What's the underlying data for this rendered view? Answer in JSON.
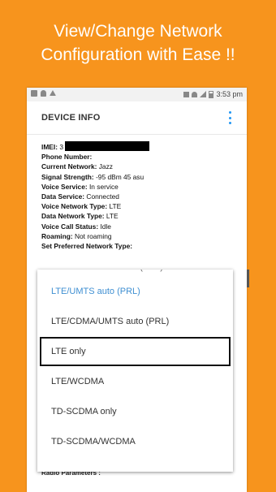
{
  "headline": {
    "line1": "View/Change Network",
    "line2": "Configuration with Ease !!"
  },
  "status_bar": {
    "time": "3:53 pm",
    "left_icons": [
      "gallery-icon",
      "notification-icon",
      "upload-icon"
    ],
    "right_icons": [
      "nfc-icon",
      "wifi-icon",
      "signal-icon",
      "battery-icon"
    ]
  },
  "appbar": {
    "title": "DEVICE INFO",
    "menu_icon": "more-vert-icon"
  },
  "device_info": [
    {
      "label": "IMEI:",
      "value": "3",
      "redacted": true
    },
    {
      "label": "Phone Number:",
      "value": ""
    },
    {
      "label": "Current Network:",
      "value": "Jazz"
    },
    {
      "label": "Signal Strength:",
      "value": "-95 dBm   45 asu"
    },
    {
      "label": "Voice Service:",
      "value": "In service"
    },
    {
      "label": "Data Service:",
      "value": "Connected"
    },
    {
      "label": "Voice Network Type:",
      "value": "LTE"
    },
    {
      "label": "Data Network Type:",
      "value": "LTE"
    },
    {
      "label": "Voice Call Status:",
      "value": "Idle"
    },
    {
      "label": "Roaming:",
      "value": "Not roaming"
    },
    {
      "label": "Set Preferred Network Type:",
      "value": ""
    }
  ],
  "dropdown": {
    "options": [
      {
        "label": "LTE/GSM/UMTS auto (PRL)",
        "state": "partial"
      },
      {
        "label": "LTE/UMTS auto (PRL)",
        "state": "selected"
      },
      {
        "label": "LTE/CDMA/UMTS auto (PRL)",
        "state": "normal"
      },
      {
        "label": "LTE only",
        "state": "highlighted"
      },
      {
        "label": "LTE/WCDMA",
        "state": "normal"
      },
      {
        "label": "TD-SCDMA only",
        "state": "normal"
      },
      {
        "label": "TD-SCDMA/WCDMA",
        "state": "normal"
      }
    ],
    "selected_color": "#3f8fd2"
  },
  "below_dropdown": "Radio Parameters :",
  "colors": {
    "background": "#f7941d",
    "headline_text": "#ffffff",
    "accent": "#2196f3"
  }
}
